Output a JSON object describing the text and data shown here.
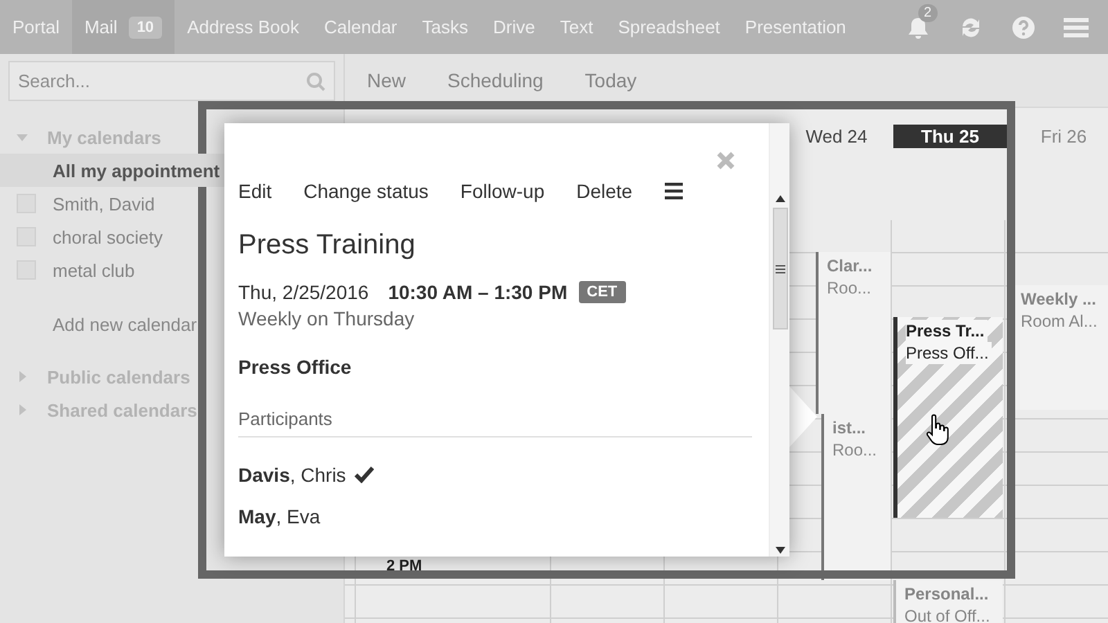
{
  "top_nav": {
    "apps": [
      {
        "label": "Portal",
        "selected": false
      },
      {
        "label": "Mail",
        "selected": true,
        "badge": "10"
      },
      {
        "label": "Address Book",
        "selected": false
      },
      {
        "label": "Calendar",
        "selected": false
      },
      {
        "label": "Tasks",
        "selected": false
      },
      {
        "label": "Drive",
        "selected": false
      },
      {
        "label": "Text",
        "selected": false
      },
      {
        "label": "Spreadsheet",
        "selected": false
      },
      {
        "label": "Presentation",
        "selected": false
      }
    ],
    "notifications_badge": "2"
  },
  "sidebar": {
    "search": {
      "placeholder": "Search..."
    },
    "sections": [
      {
        "label": "My calendars",
        "expanded": true,
        "items": [
          {
            "label": "All my appointment",
            "kind": "all",
            "selected": true
          },
          {
            "label": "Smith, David",
            "kind": "calendar",
            "selected": false,
            "checked": false
          },
          {
            "label": "choral society",
            "kind": "calendar",
            "selected": false,
            "checked": false
          },
          {
            "label": "metal club",
            "kind": "calendar",
            "selected": false,
            "checked": false
          }
        ],
        "add_link": "Add new calendar"
      },
      {
        "label": "Public calendars",
        "expanded": false
      },
      {
        "label": "Shared calendars",
        "expanded": false
      }
    ]
  },
  "toolbar": [
    "New",
    "Scheduling",
    "Today"
  ],
  "calendar": {
    "days": [
      {
        "label": "Wed 24",
        "selected": false
      },
      {
        "label": "Thu 25",
        "selected": true
      },
      {
        "label": "Fri 26",
        "selected": false
      }
    ],
    "time_label": "2 PM",
    "events": [
      {
        "title": "Clar...",
        "subtitle": "Roo...",
        "kind": "plain"
      },
      {
        "title": "ist...",
        "subtitle": "Roo...",
        "kind": "plain"
      },
      {
        "title": "Press Tr...",
        "subtitle": "Press Off...",
        "kind": "striped"
      },
      {
        "title": "Weekly ...",
        "subtitle": "Room Al...",
        "kind": "faded"
      },
      {
        "title": "Personal...",
        "subtitle": "Out of Off...",
        "kind": "faded"
      }
    ]
  },
  "popup": {
    "actions": [
      "Edit",
      "Change status",
      "Follow-up",
      "Delete"
    ],
    "title": "Press Training",
    "date": "Thu, 2/25/2016",
    "time": "10:30 AM – 1:30 PM",
    "timezone": "CET",
    "recurrence": "Weekly on Thursday",
    "location": "Press Office",
    "participants_heading": "Participants",
    "participants": [
      {
        "name": "**Davis**, Chris",
        "accepted": true
      },
      {
        "name": "**May**, Eva",
        "accepted": false
      }
    ]
  }
}
